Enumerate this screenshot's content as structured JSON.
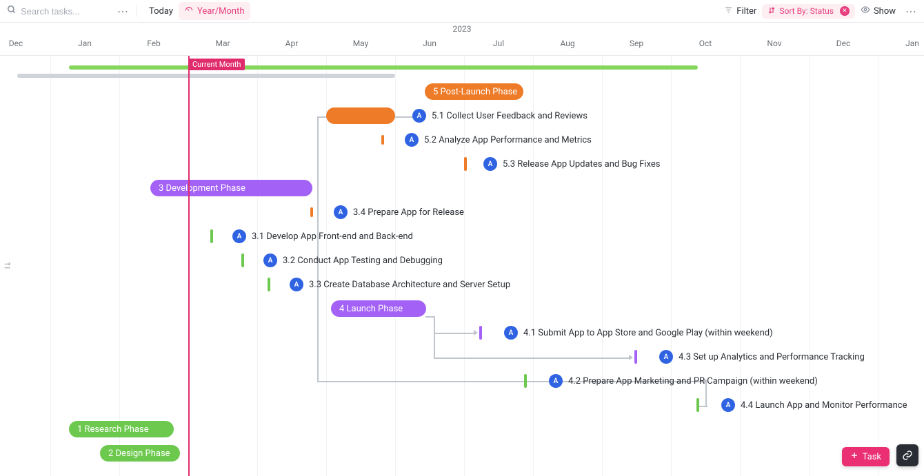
{
  "toolbar": {
    "search_placeholder": "Search tasks...",
    "today": "Today",
    "zoom": "Year/Month",
    "filter": "Filter",
    "sortby": "Sort By: Status",
    "show": "Show"
  },
  "timeline": {
    "year": "2023",
    "months": [
      "Dec",
      "Jan",
      "Feb",
      "Mar",
      "Apr",
      "May",
      "Jun",
      "Jul",
      "Aug",
      "Sep",
      "Oct",
      "Nov",
      "Dec",
      "Jan"
    ],
    "today_label": "Current Month"
  },
  "phases": {
    "p5": "5 Post-Launch Phase",
    "p3": "3 Development Phase",
    "p4": "4 Launch Phase",
    "p1": "1 Research Phase",
    "p2": "2 Design Phase"
  },
  "tasks": {
    "t51": "5.1 Collect User Feedback and Reviews",
    "t52": "5.2 Analyze App Performance and Metrics",
    "t53": "5.3 Release App Updates and Bug Fixes",
    "t34": "3.4 Prepare App for Release",
    "t31": "3.1 Develop App Front-end and Back-end",
    "t32": "3.2 Conduct App Testing and Debugging",
    "t33": "3.3 Create Database Architecture and Server Setup",
    "t41": "4.1 Submit App to App Store and Google Play (within weekend)",
    "t43": "4.3 Set up Analytics and Performance Tracking",
    "t42": "4.2 Prepare App Marketing and PR Campaign (within weekend)",
    "t44": "4.4 Launch App and Monitor Performance"
  },
  "avatar_initial": "A",
  "actions": {
    "new_task": "Task"
  }
}
